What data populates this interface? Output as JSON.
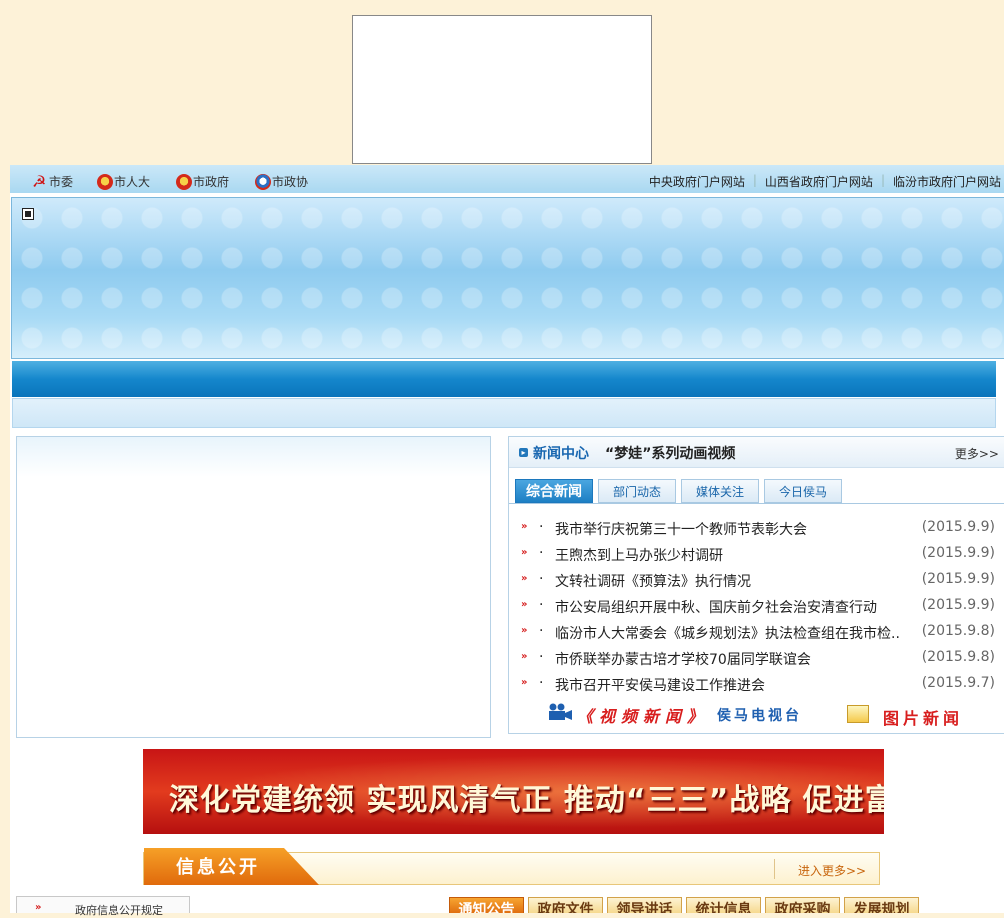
{
  "top_links": {
    "left": [
      {
        "label": "市委",
        "icon": "party-emblem-icon"
      },
      {
        "label": "市人大",
        "icon": "national-emblem-icon"
      },
      {
        "label": "市政府",
        "icon": "national-emblem-icon"
      },
      {
        "label": "市政协",
        "icon": "cppcc-emblem-icon"
      }
    ],
    "right": [
      "中央政府门户网站",
      "山西省政府门户网站",
      "临汾市政府门户网站"
    ],
    "separator": "|"
  },
  "news": {
    "title": "新闻中心",
    "subtitle": "“梦娃”系列动画视频",
    "more": "更多>>",
    "tabs": [
      {
        "label": "综合新闻",
        "active": true
      },
      {
        "label": "部门动态",
        "active": false
      },
      {
        "label": "媒体关注",
        "active": false
      },
      {
        "label": "今日侯马",
        "active": false
      }
    ],
    "bullet_arrow": "»",
    "bullet_dot": "·",
    "items": [
      {
        "text": "我市举行庆祝第三十一个教师节表彰大会",
        "date": "(2015.9.9)"
      },
      {
        "text": "王煦杰到上马办张少村调研",
        "date": "(2015.9.9)"
      },
      {
        "text": "文转社调研《预算法》执行情况",
        "date": "(2015.9.9)"
      },
      {
        "text": "市公安局组织开展中秋、国庆前夕社会治安清查行动",
        "date": "(2015.9.9)"
      },
      {
        "text": "临汾市人大常委会《城乡规划法》执法检查组在我市检..",
        "date": "(2015.9.8)"
      },
      {
        "text": "市侨联举办蒙古培才学校70届同学联谊会",
        "date": "(2015.9.8)"
      },
      {
        "text": "我市召开平安侯马建设工作推进会",
        "date": "(2015.9.7)"
      }
    ],
    "video_label": "《视频新闻》",
    "video_sub": "侯马电视台",
    "photo_label": "图片新闻"
  },
  "slogan": "深化党建统领 实现风清气正 推动“三三”战略 促进富民强市",
  "info": {
    "title": "信息公开",
    "more": "进入更多>>"
  },
  "policy": {
    "arrow": "»",
    "label": "政府信息公开规定"
  },
  "bottom_tabs": [
    {
      "label": "通知公告",
      "active": true
    },
    {
      "label": "政府文件",
      "active": false
    },
    {
      "label": "领导讲话",
      "active": false
    },
    {
      "label": "统计信息",
      "active": false
    },
    {
      "label": "政府采购",
      "active": false
    },
    {
      "label": "发展规划",
      "active": false
    }
  ],
  "colors": {
    "page_bg": "#fdf2d8",
    "accent_blue": "#1587cc",
    "accent_red": "#d81e1e",
    "accent_orange": "#e06f10"
  }
}
